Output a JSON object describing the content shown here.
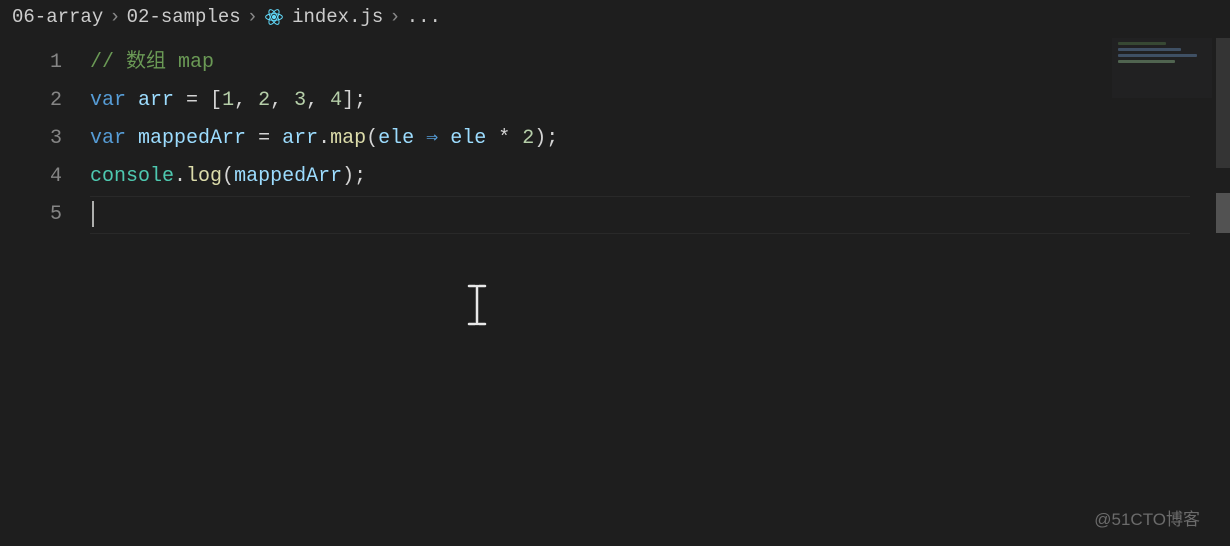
{
  "breadcrumb": {
    "items": [
      "06-array",
      "02-samples",
      "index.js",
      "..."
    ],
    "icon": "react-icon"
  },
  "code": {
    "lines": [
      {
        "n": "1",
        "tokens": [
          {
            "t": "// 数组 map",
            "c": "tok-comment"
          }
        ]
      },
      {
        "n": "2",
        "tokens": [
          {
            "t": "var",
            "c": "tok-keyword"
          },
          {
            "t": " ",
            "c": ""
          },
          {
            "t": "arr",
            "c": "tok-var"
          },
          {
            "t": " = [",
            "c": "tok-punct"
          },
          {
            "t": "1",
            "c": "tok-num"
          },
          {
            "t": ", ",
            "c": "tok-punct"
          },
          {
            "t": "2",
            "c": "tok-num"
          },
          {
            "t": ", ",
            "c": "tok-punct"
          },
          {
            "t": "3",
            "c": "tok-num"
          },
          {
            "t": ", ",
            "c": "tok-punct"
          },
          {
            "t": "4",
            "c": "tok-num"
          },
          {
            "t": "];",
            "c": "tok-punct"
          }
        ]
      },
      {
        "n": "3",
        "tokens": [
          {
            "t": "var",
            "c": "tok-keyword"
          },
          {
            "t": " ",
            "c": ""
          },
          {
            "t": "mappedArr",
            "c": "tok-var"
          },
          {
            "t": " = ",
            "c": "tok-punct"
          },
          {
            "t": "arr",
            "c": "tok-var"
          },
          {
            "t": ".",
            "c": "tok-punct"
          },
          {
            "t": "map",
            "c": "tok-prop"
          },
          {
            "t": "(",
            "c": "tok-punct"
          },
          {
            "t": "ele",
            "c": "tok-param"
          },
          {
            "t": " ⇒ ",
            "c": "tok-keyword"
          },
          {
            "t": "ele",
            "c": "tok-param"
          },
          {
            "t": " * ",
            "c": "tok-op"
          },
          {
            "t": "2",
            "c": "tok-num"
          },
          {
            "t": ");",
            "c": "tok-punct"
          }
        ]
      },
      {
        "n": "4",
        "tokens": [
          {
            "t": "console",
            "c": "tok-obj"
          },
          {
            "t": ".",
            "c": "tok-punct"
          },
          {
            "t": "log",
            "c": "tok-prop"
          },
          {
            "t": "(",
            "c": "tok-punct"
          },
          {
            "t": "mappedArr",
            "c": "tok-var"
          },
          {
            "t": ");",
            "c": "tok-punct"
          }
        ]
      },
      {
        "n": "5",
        "tokens": []
      }
    ]
  },
  "minimap": {
    "lines": [
      {
        "w": "55%",
        "bg": "#4d6b45"
      },
      {
        "w": "72%",
        "bg": "#5a7a9e"
      },
      {
        "w": "90%",
        "bg": "#5a7a9e"
      },
      {
        "w": "65%",
        "bg": "#7a9e7a"
      }
    ]
  },
  "watermark": "@51CTO博客"
}
